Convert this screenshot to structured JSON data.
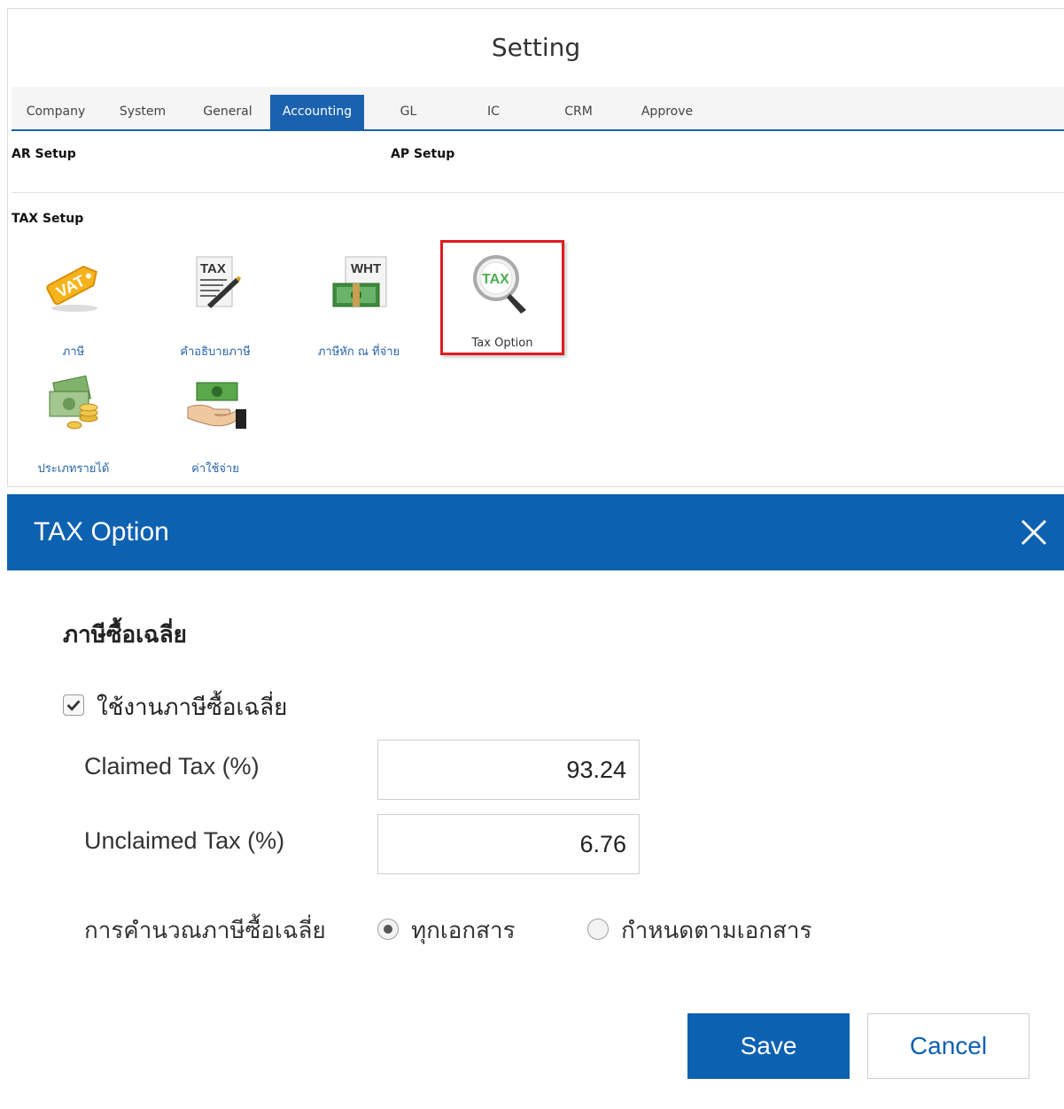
{
  "page": {
    "title": "Setting"
  },
  "tabs": [
    {
      "label": "Company",
      "active": false
    },
    {
      "label": "System",
      "active": false
    },
    {
      "label": "General",
      "active": false
    },
    {
      "label": "Accounting",
      "active": true
    },
    {
      "label": "GL",
      "active": false
    },
    {
      "label": "IC",
      "active": false
    },
    {
      "label": "CRM",
      "active": false
    },
    {
      "label": "Approve",
      "active": false
    }
  ],
  "sections": {
    "ar_setup": "AR Setup",
    "ap_setup": "AP Setup",
    "tax_setup": "TAX Setup"
  },
  "tiles": [
    {
      "label": "ภาษี",
      "icon": "vat-tag-icon"
    },
    {
      "label": "คำอธิบายภาษี",
      "icon": "tax-document-pen-icon",
      "badge": "TAX"
    },
    {
      "label": "ภาษีหัก ณ ที่จ่าย",
      "icon": "wht-money-icon",
      "badge": "WHT"
    },
    {
      "label": "Tax Option",
      "icon": "tax-magnifier-icon",
      "badge": "TAX",
      "highlighted": true
    },
    {
      "label": "ประเภทรายได้",
      "icon": "money-coins-icon"
    },
    {
      "label": "ค่าใช้จ่าย",
      "icon": "hand-money-icon"
    }
  ],
  "modal": {
    "title": "TAX Option",
    "section_heading": "ภาษีซื้อเฉลี่ย",
    "enable_label": "ใช้งานภาษีซื้อเฉลี่ย",
    "enable_checked": true,
    "claimed_label": "Claimed Tax (%)",
    "claimed_value": "93.24",
    "unclaimed_label": "Unclaimed Tax (%)",
    "unclaimed_value": "6.76",
    "calc_label": "การคำนวณภาษีซื้อเฉลี่ย",
    "calc_options": [
      {
        "label": "ทุกเอกสาร",
        "selected": true
      },
      {
        "label": "กำหนดตามเอกสาร",
        "selected": false
      }
    ],
    "save_label": "Save",
    "cancel_label": "Cancel"
  },
  "colors": {
    "accent": "#1a62b0",
    "modal_header": "#0d61b1",
    "highlight_border": "#e01b22",
    "link_text": "#2865a8"
  }
}
